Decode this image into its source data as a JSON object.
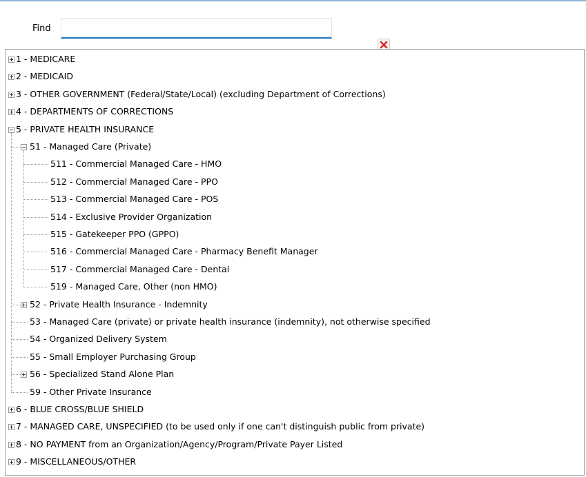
{
  "find": {
    "label": "Find",
    "value": "",
    "clear_icon": "clear-x-icon",
    "clear_color": "#e0221c",
    "accent": "#1e73be"
  },
  "tree": {
    "nodes": [
      {
        "id": "1",
        "label": "1 - MEDICARE",
        "depth": 0,
        "state": "collapsed"
      },
      {
        "id": "2",
        "label": "2 - MEDICAID",
        "depth": 0,
        "state": "collapsed"
      },
      {
        "id": "3",
        "label": "3 - OTHER GOVERNMENT (Federal/State/Local) (excluding Department of Corrections)",
        "depth": 0,
        "state": "collapsed"
      },
      {
        "id": "4",
        "label": "4 - DEPARTMENTS OF CORRECTIONS",
        "depth": 0,
        "state": "collapsed"
      },
      {
        "id": "5",
        "label": "5 - PRIVATE HEALTH INSURANCE",
        "depth": 0,
        "state": "expanded"
      },
      {
        "id": "51",
        "label": "51 - Managed Care (Private)",
        "depth": 1,
        "state": "expanded"
      },
      {
        "id": "511",
        "label": "511 - Commercial Managed Care - HMO",
        "depth": 2,
        "state": "leaf"
      },
      {
        "id": "512",
        "label": "512 - Commercial Managed Care - PPO",
        "depth": 2,
        "state": "leaf"
      },
      {
        "id": "513",
        "label": "513 - Commercial Managed Care - POS",
        "depth": 2,
        "state": "leaf"
      },
      {
        "id": "514",
        "label": "514 - Exclusive Provider Organization",
        "depth": 2,
        "state": "leaf"
      },
      {
        "id": "515",
        "label": "515 - Gatekeeper PPO (GPPO)",
        "depth": 2,
        "state": "leaf"
      },
      {
        "id": "516",
        "label": "516 - Commercial Managed Care - Pharmacy Benefit Manager",
        "depth": 2,
        "state": "leaf"
      },
      {
        "id": "517",
        "label": "517 - Commercial Managed Care - Dental",
        "depth": 2,
        "state": "leaf"
      },
      {
        "id": "519",
        "label": "519 - Managed Care, Other (non HMO)",
        "depth": 2,
        "state": "leaf"
      },
      {
        "id": "52",
        "label": "52 - Private Health Insurance - Indemnity",
        "depth": 1,
        "state": "collapsed"
      },
      {
        "id": "53",
        "label": "53 - Managed Care (private) or private health insurance (indemnity), not otherwise specified",
        "depth": 1,
        "state": "leaf"
      },
      {
        "id": "54",
        "label": "54 - Organized Delivery System",
        "depth": 1,
        "state": "leaf"
      },
      {
        "id": "55",
        "label": "55 - Small Employer Purchasing Group",
        "depth": 1,
        "state": "leaf"
      },
      {
        "id": "56",
        "label": "56 - Specialized Stand Alone Plan",
        "depth": 1,
        "state": "collapsed"
      },
      {
        "id": "59",
        "label": "59 - Other Private Insurance",
        "depth": 1,
        "state": "leaf"
      },
      {
        "id": "6",
        "label": "6 - BLUE CROSS/BLUE SHIELD",
        "depth": 0,
        "state": "collapsed"
      },
      {
        "id": "7",
        "label": "7 - MANAGED CARE, UNSPECIFIED (to be used only if one can't distinguish public from private)",
        "depth": 0,
        "state": "collapsed"
      },
      {
        "id": "8",
        "label": "8 - NO PAYMENT from an Organization/Agency/Program/Private Payer Listed",
        "depth": 0,
        "state": "collapsed"
      },
      {
        "id": "9",
        "label": "9 - MISCELLANEOUS/OTHER",
        "depth": 0,
        "state": "collapsed"
      }
    ]
  }
}
